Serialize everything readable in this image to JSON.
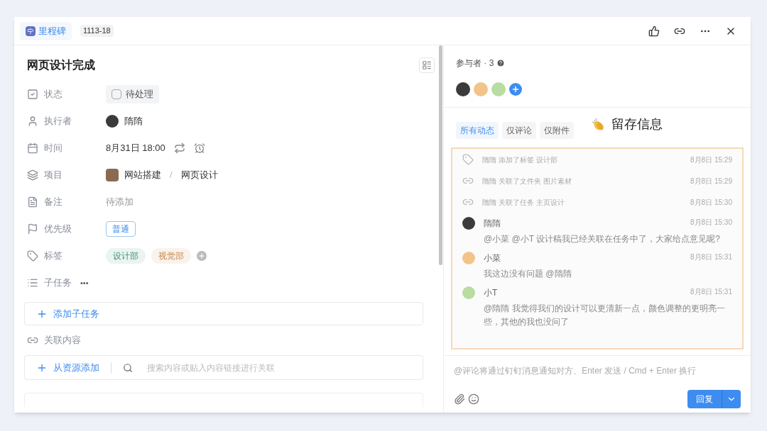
{
  "header": {
    "type_label": "里程碑",
    "id_badge": "1113-18"
  },
  "task": {
    "title": "网页设计完成",
    "fields": [
      {
        "kind": "status",
        "label": "状态",
        "value": "待处理",
        "checked": false
      },
      {
        "kind": "assignee",
        "label": "执行者",
        "value": "隋隋"
      },
      {
        "kind": "time",
        "label": "时间",
        "value": "8月31日 18:00"
      },
      {
        "kind": "project",
        "label": "项目",
        "value": "网站搭建",
        "separator": "/",
        "sub": "网页设计"
      },
      {
        "kind": "note",
        "label": "备注",
        "value": "待添加"
      },
      {
        "kind": "priority",
        "label": "优先级",
        "value": "普通"
      },
      {
        "kind": "tags",
        "label": "标签",
        "tags": [
          {
            "text": "设计部",
            "color": "#3f8f6f"
          },
          {
            "text": "视觉部",
            "color": "#c8894a"
          }
        ]
      },
      {
        "kind": "subtasks",
        "label": "子任务",
        "more": "•••"
      }
    ],
    "add_subtask": "添加子任务",
    "related_label": "关联内容",
    "add_from_resource": "从资源添加",
    "related_search": {
      "placeholder": "搜索内容或贴入内容链接进行关联"
    }
  },
  "participants": {
    "label": "参与者 · 3"
  },
  "activity_filters": [
    {
      "label": "所有动态",
      "selected": true
    },
    {
      "label": "仅评论",
      "selected": false
    },
    {
      "label": "仅附件",
      "selected": false
    }
  ],
  "annotation": {
    "text": "留存信息"
  },
  "activity": [
    {
      "kind": "tag",
      "text": "隋隋 添加了标签 设计部",
      "time": "8月8日 15:29"
    },
    {
      "kind": "link",
      "text": "隋隋 关联了文件夹 图片素材",
      "time": "8月8日 15:29"
    },
    {
      "kind": "link",
      "text": "隋隋 关联了任务 主页设计",
      "time": "8月8日 15:30"
    },
    {
      "kind": "comment",
      "name": "隋隋",
      "time": "8月8日 15:30",
      "text": "@小菜 @小T 设计稿我已经关联在任务中了，大家给点意见呢?"
    },
    {
      "kind": "comment",
      "name": "小菜",
      "time": "8月8日 15:31",
      "text": "我这边没有问题 @隋隋"
    },
    {
      "kind": "comment",
      "name": "小T",
      "time": "8月8日 15:31",
      "text": "@隋隋 我觉得我们的设计可以更清新一点，颜色调整的更明亮一些，其他的我也没问了"
    }
  ],
  "comment_box": {
    "placeholder": "@评论将通过钉钉消息通知对方、Enter 发送 / Cmd + Enter 换行"
  },
  "reply_button": "回复"
}
